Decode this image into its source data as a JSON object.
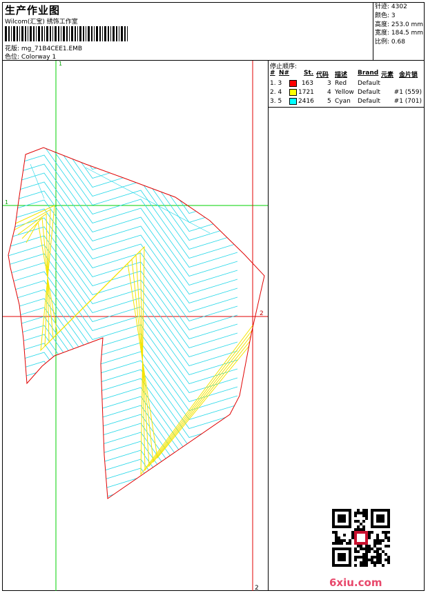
{
  "header": {
    "title": "生产作业图",
    "subtitle": "Wilcom(汇宝) 绣饰工作室",
    "design_label": "花版: ",
    "design_value": "mg_71B4CEE1.EMB",
    "colorway_label": "色位: ",
    "colorway_value": "Colorway 1"
  },
  "stats": [
    {
      "label": "针迹: ",
      "value": "4302"
    },
    {
      "label": "颜色: ",
      "value": "3"
    },
    {
      "label": "高度: ",
      "value": "253.0 mm"
    },
    {
      "label": "宽度: ",
      "value": "184.5 mm"
    },
    {
      "label": "比例: ",
      "value": "0.68"
    }
  ],
  "stop_sequence": {
    "title": "停止顺序:",
    "columns": [
      "#",
      "N#",
      "St.",
      "代码",
      "描述",
      "Brand",
      "元素",
      "金片锁"
    ],
    "rows": [
      {
        "num": "1. 3",
        "color": "#ff0000",
        "stitches": "163",
        "code": "3",
        "desc": "Red",
        "brand": "Default",
        "element": ""
      },
      {
        "num": "2. 4",
        "color": "#ffff00",
        "stitches": "1721",
        "code": "4",
        "desc": "Yellow",
        "brand": "Default",
        "element": "#1 (559)"
      },
      {
        "num": "3. 5",
        "color": "#00ffff",
        "stitches": "2416",
        "code": "5",
        "desc": "Cyan",
        "brand": "Default",
        "element": "#1 (701)"
      }
    ]
  },
  "guides": {
    "v1_label": "1",
    "h1_label": "1",
    "h2_label": "2",
    "v2_label": "2"
  },
  "colors": {
    "outline": "#e00000",
    "fill_stitch": "#22d7e8",
    "underlay": "#f5e400",
    "guide_green": "#00d000",
    "guide_red": "#e00000"
  },
  "watermark": "6xiu.com"
}
